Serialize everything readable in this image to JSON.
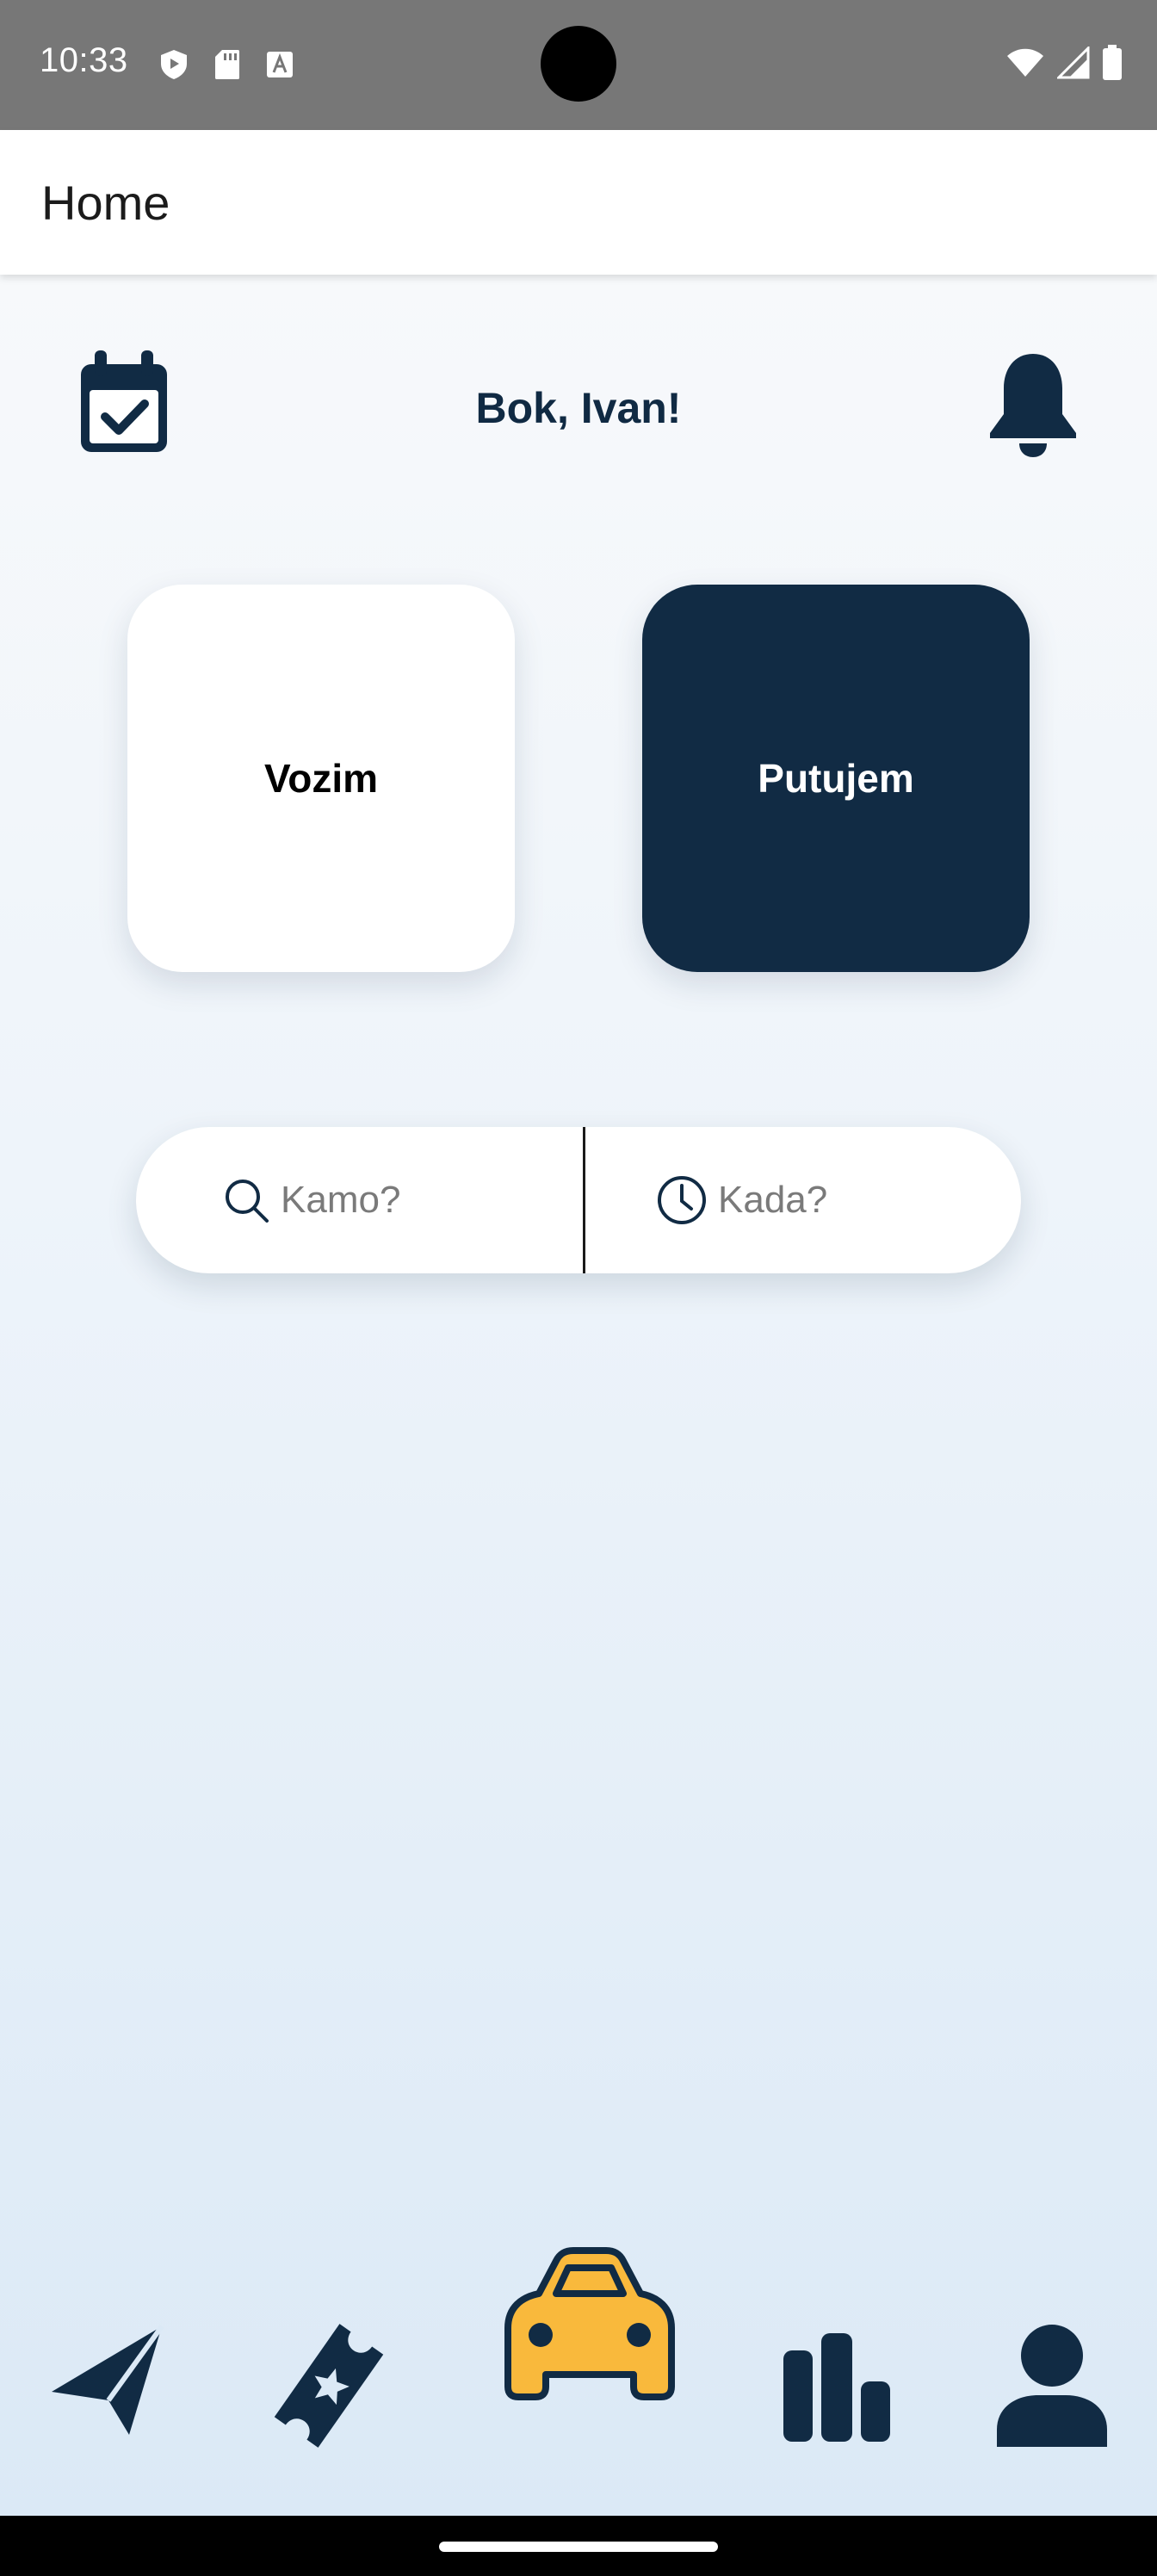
{
  "status_bar": {
    "time": "10:33",
    "left_icons": [
      "shield-icon",
      "sd-card-icon",
      "keyboard-a-icon"
    ],
    "right_icons": [
      "wifi-icon",
      "cellular-signal-icon",
      "battery-icon"
    ]
  },
  "app_bar": {
    "title": "Home"
  },
  "header": {
    "greeting": "Bok, Ivan!",
    "left_icon": "calendar-check-icon",
    "right_icon": "bell-icon"
  },
  "mode_cards": {
    "vozim": {
      "label": "Vozim",
      "selected": false
    },
    "putujem": {
      "label": "Putujem",
      "selected": true
    }
  },
  "search": {
    "where_placeholder": "Kamo?",
    "when_placeholder": "Kada?"
  },
  "bottom_nav": {
    "items": [
      {
        "icon": "paper-plane-icon",
        "active": false
      },
      {
        "icon": "ticket-star-icon",
        "active": false
      },
      {
        "icon": "car-icon",
        "active": true
      },
      {
        "icon": "bar-chart-icon",
        "active": false
      },
      {
        "icon": "user-icon",
        "active": false
      }
    ]
  },
  "colors": {
    "primary_dark": "#112b44",
    "accent_yellow": "#f9b93c",
    "status_bar_gray": "#777777"
  }
}
